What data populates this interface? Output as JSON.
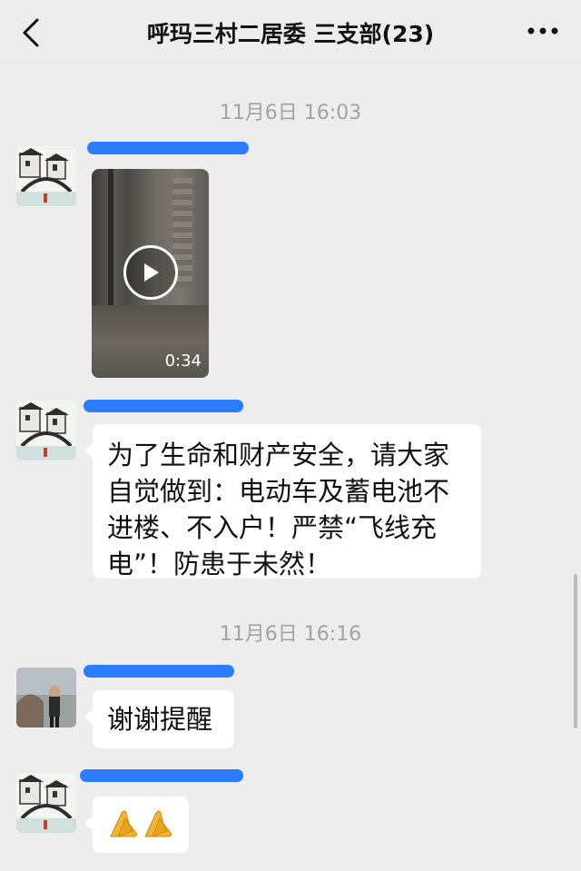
{
  "header": {
    "title": "呼玛三村二居委 三支部(23)",
    "back_icon": "chevron-left-icon",
    "more_icon": "more-dots-icon"
  },
  "messages": [
    {
      "type": "timestamp",
      "text": "11月6日 16:03"
    },
    {
      "type": "video",
      "duration": "0:34",
      "avatar": "village-bridge-avatar"
    },
    {
      "type": "text",
      "text": "为了生命和财产安全，请大家自觉做到：电动车及蓄电池不进楼、不入户！严禁“飞线充电”！防患于未然！",
      "avatar": "village-bridge-avatar",
      "lines": [
        "为了生命和财产安全，请大家",
        "自觉做到：电动车及蓄电池不",
        "进楼、不入户！严禁“飞线充",
        "电”！防患于未然！"
      ]
    },
    {
      "type": "timestamp",
      "text": "11月6日 16:16"
    },
    {
      "type": "text",
      "text": "谢谢提醒",
      "avatar": "person-photo-avatar"
    },
    {
      "type": "text",
      "text": "🙏🙏",
      "avatar": "village-bridge-avatar"
    }
  ],
  "colors": {
    "background": "#ededed",
    "bubble": "#ffffff",
    "redaction": "#2b7cff",
    "timestamp": "#a3a3a3"
  }
}
